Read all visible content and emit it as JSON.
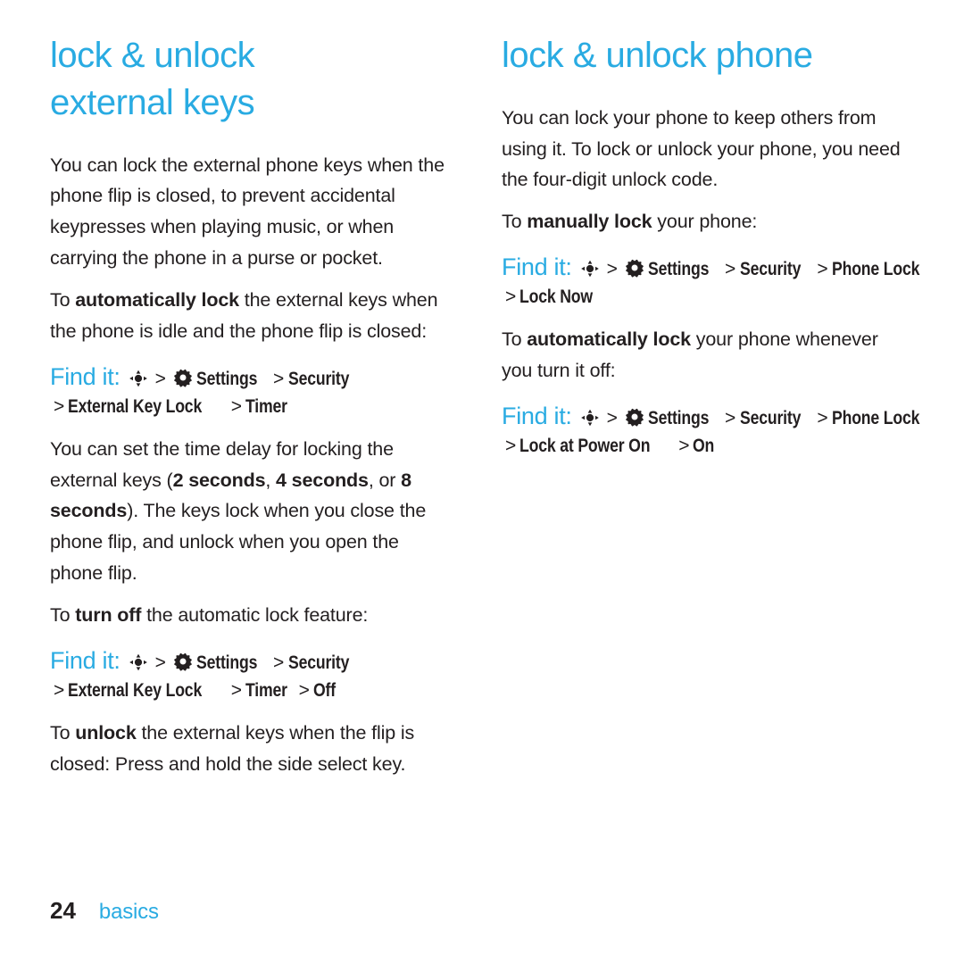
{
  "page": {
    "number": "24",
    "section": "basics",
    "accent_color": "#29abe2",
    "text_color": "#231f20"
  },
  "left_column": {
    "title_line1": "lock & unlock",
    "title_line2": "external keys",
    "paragraphs": [
      {
        "id": "p1",
        "runs": [
          {
            "text": "You can lock the external phone keys when the phone flip is closed, to prevent accidental keypresses when playing music, or when carrying the phone in a purse or pocket.",
            "bold": false
          }
        ]
      },
      {
        "id": "p2",
        "runs": [
          {
            "text": "To ",
            "bold": false
          },
          {
            "text": "automatically lock",
            "bold": true
          },
          {
            "text": " the external keys when the phone is idle and the phone flip is closed:",
            "bold": false
          }
        ]
      }
    ],
    "findit_1": {
      "label": "Find it:",
      "icon1": "center-select-key-icon",
      "sep": ">",
      "icon2": "settings-gear-icon",
      "steps_line1": [
        "Settings",
        "Security"
      ],
      "steps_line2": [
        "External Key Lock",
        "Timer"
      ]
    },
    "paragraphs_2": [
      {
        "id": "p3",
        "runs": [
          {
            "text": "You can set the time delay for locking the external keys (",
            "bold": false
          },
          {
            "text": "2 seconds",
            "bold": true
          },
          {
            "text": ", ",
            "bold": false
          },
          {
            "text": "4 seconds",
            "bold": true
          },
          {
            "text": ", or ",
            "bold": false
          },
          {
            "text": "8 seconds",
            "bold": true
          },
          {
            "text": "). The keys lock when you close the phone flip, and unlock when you open the phone flip.",
            "bold": false
          }
        ]
      },
      {
        "id": "p4",
        "runs": [
          {
            "text": "To ",
            "bold": false
          },
          {
            "text": "turn off",
            "bold": true
          },
          {
            "text": " the automatic lock feature:",
            "bold": false
          }
        ]
      }
    ],
    "findit_2": {
      "label": "Find it:",
      "icon1": "center-select-key-icon",
      "sep": ">",
      "icon2": "settings-gear-icon",
      "steps_line1": [
        "Settings",
        "Security"
      ],
      "steps_line2": [
        "External Key Lock",
        "Timer",
        "Off"
      ]
    },
    "paragraphs_3": [
      {
        "id": "p5",
        "runs": [
          {
            "text": "To ",
            "bold": false
          },
          {
            "text": "unlock",
            "bold": true
          },
          {
            "text": " the external keys when the flip is closed: Press and hold the side select key.",
            "bold": false
          }
        ]
      }
    ]
  },
  "right_column": {
    "title_line1": "lock & unlock phone",
    "paragraphs": [
      {
        "id": "r1",
        "runs": [
          {
            "text": "You can lock your phone to keep others from using it. To lock or unlock your phone, you need the four-digit unlock code.",
            "bold": false
          }
        ]
      },
      {
        "id": "r2",
        "runs": [
          {
            "text": "To ",
            "bold": false
          },
          {
            "text": "manually lock",
            "bold": true
          },
          {
            "text": " your phone:",
            "bold": false
          }
        ]
      }
    ],
    "findit_1": {
      "label": "Find it:",
      "icon1": "center-select-key-icon",
      "sep": ">",
      "icon2": "settings-gear-icon",
      "steps_line1": [
        "Settings",
        "Security",
        "Phone Lock"
      ],
      "steps_line2": [
        "Lock Now"
      ]
    },
    "paragraphs_2": [
      {
        "id": "r3",
        "runs": [
          {
            "text": "To ",
            "bold": false
          },
          {
            "text": "automatically lock",
            "bold": true
          },
          {
            "text": " your phone whenever you turn it off:",
            "bold": false
          }
        ]
      }
    ],
    "findit_2": {
      "label": "Find it:",
      "icon1": "center-select-key-icon",
      "sep": ">",
      "icon2": "settings-gear-icon",
      "steps_line1": [
        "Settings",
        "Security",
        "Phone Lock"
      ],
      "steps_line2": [
        "Lock at Power On",
        "On"
      ]
    }
  }
}
